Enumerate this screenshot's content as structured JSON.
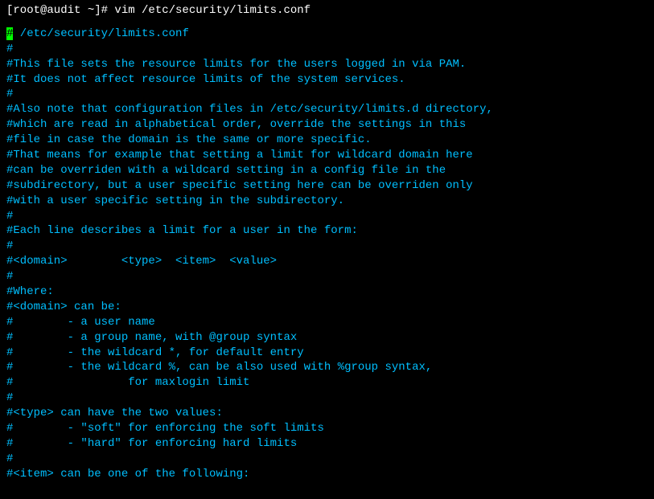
{
  "prompt_prefix": "[root@audit ~]# ",
  "command": "vim /etc/security/limits.conf",
  "cursor_char": "#",
  "file_header": " /etc/security/limits.conf",
  "lines": [
    "#",
    "#This file sets the resource limits for the users logged in via PAM.",
    "#It does not affect resource limits of the system services.",
    "#",
    "#Also note that configuration files in /etc/security/limits.d directory,",
    "#which are read in alphabetical order, override the settings in this",
    "#file in case the domain is the same or more specific.",
    "#That means for example that setting a limit for wildcard domain here",
    "#can be overriden with a wildcard setting in a config file in the",
    "#subdirectory, but a user specific setting here can be overriden only",
    "#with a user specific setting in the subdirectory.",
    "#",
    "#Each line describes a limit for a user in the form:",
    "#",
    "#<domain>        <type>  <item>  <value>",
    "#",
    "#Where:",
    "#<domain> can be:",
    "#        - a user name",
    "#        - a group name, with @group syntax",
    "#        - the wildcard *, for default entry",
    "#        - the wildcard %, can be also used with %group syntax,",
    "#                 for maxlogin limit",
    "#",
    "#<type> can have the two values:",
    "#        - \"soft\" for enforcing the soft limits",
    "#        - \"hard\" for enforcing hard limits",
    "#",
    "#<item> can be one of the following:"
  ]
}
